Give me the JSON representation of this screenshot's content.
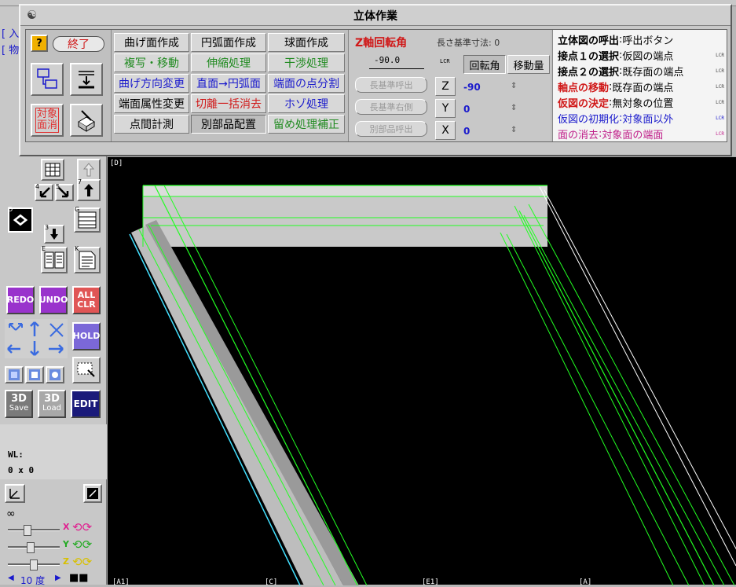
{
  "left_strip": {
    "frag1": "[ 入",
    "frag2": "[ 物"
  },
  "dialog": {
    "title": "立体作業",
    "help_label": "?",
    "close_label": "終了",
    "target_clear_label": "対象面消",
    "menu": [
      [
        "曲げ面作成",
        "円弧面作成",
        "球面作成"
      ],
      [
        "複写・移動",
        "伸縮処理",
        "干渉処理"
      ],
      [
        "曲げ方向変更",
        "直面→円弧面",
        "端面の点分割"
      ],
      [
        "端面属性変更",
        "切離一括消去",
        "ホゾ処理"
      ],
      [
        "点間計測",
        "別部品配置",
        "留め処理補正"
      ]
    ],
    "menu_colors": [
      [
        "#000000",
        "#000000",
        "#000000"
      ],
      [
        "#1f8a1f",
        "#1f8a1f",
        "#1f8a1f"
      ],
      [
        "#1a1acc",
        "#1a1acc",
        "#1a1acc"
      ],
      [
        "#000000",
        "#d01818",
        "#1a1acc"
      ],
      [
        "#000000",
        "#000000",
        "#1f8a1f"
      ]
    ],
    "rotation": {
      "title": "Z軸回転角",
      "base_dim_label": "長さ基準寸法: 0",
      "angle_value": "-90.0",
      "rotate_btn": "回転角",
      "move_btn": "移動量",
      "disabled1": "長基準呼出",
      "disabled2": "長基準右側",
      "disabled3": "別部品呼出",
      "axes": [
        {
          "axis": "Z",
          "value": "-90"
        },
        {
          "axis": "Y",
          "value": "0"
        },
        {
          "axis": "X",
          "value": "0"
        }
      ]
    },
    "help_lines": [
      {
        "key": "立体図の呼出",
        "sep": ":",
        "val": "呼出ボタン",
        "key_color": "#000000",
        "val_color": "#000000"
      },
      {
        "key": "接点１の選択",
        "sep": ":",
        "val": "仮図の端点",
        "key_color": "#000000",
        "val_color": "#000000"
      },
      {
        "key": "接点２の選択",
        "sep": ":",
        "val": "既存面の端点",
        "key_color": "#000000",
        "val_color": "#000000"
      },
      {
        "key": "軸点の移動",
        "sep": ":",
        "val": "既存面の端点",
        "key_color": "#d01818",
        "val_color": "#000000"
      },
      {
        "key": "仮図の決定",
        "sep": ":",
        "val": "無対象の位置",
        "key_color": "#d01818",
        "val_color": "#000000"
      },
      {
        "key": "仮図の初期化",
        "sep": ":",
        "val": "対象面以外",
        "key_color": "#1a1acc",
        "val_color": "#1a1acc"
      },
      {
        "key": "面の消去",
        "sep": ":",
        "val": "対象面の端面",
        "key_color": "#c0208a",
        "val_color": "#c0208a"
      }
    ],
    "lcr": "LCR"
  },
  "toolbar": {
    "redo": "REDO",
    "undo": "UNDO",
    "allclr_1": "ALL",
    "allclr_2": "CLR",
    "hold": "HOLD",
    "save_1": "3D",
    "save_2": "Save",
    "load_1": "3D",
    "load_2": "Load",
    "edit": "EDIT",
    "wl_label": "WL:",
    "wl_value": "0 x 0",
    "infinity": "∞",
    "slider_x": "X",
    "slider_y": "Y",
    "slider_z": "Z",
    "step_value": "10 度",
    "icon_nums": {
      "n4": "4",
      "n5": "5",
      "n7": "7",
      "n3": "3",
      "nD": "D",
      "nG": "G",
      "nE": "E",
      "nK": "K"
    }
  },
  "viewport": {
    "label_d": "[D]",
    "label_1": "[A1]",
    "label_2": "[C]",
    "label_3": "[E1]",
    "label_4": "[A]"
  }
}
